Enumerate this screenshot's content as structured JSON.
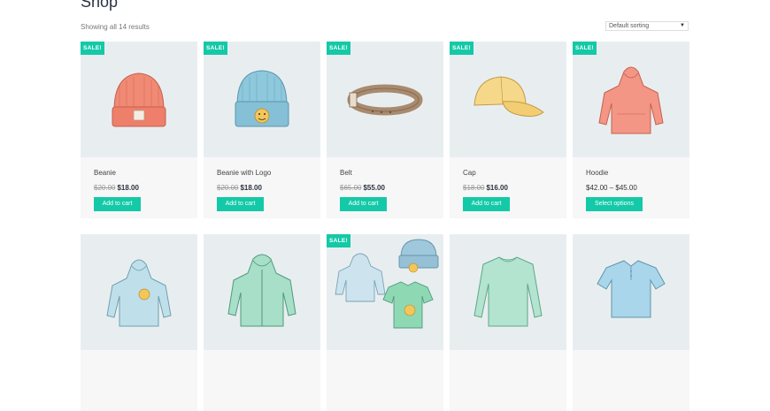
{
  "page": {
    "title": "Shop",
    "results": "Showing all 14 results",
    "sort_selected": "Default sorting"
  },
  "products": [
    {
      "name": "Beanie",
      "old_price": "$20.00",
      "price": "$18.00",
      "sale": "SALE!",
      "button": "Add to cart",
      "icon": "beanie-icon"
    },
    {
      "name": "Beanie with Logo",
      "old_price": "$20.00",
      "price": "$18.00",
      "sale": "SALE!",
      "button": "Add to cart",
      "icon": "beanie-logo-icon"
    },
    {
      "name": "Belt",
      "old_price": "$65.00",
      "price": "$55.00",
      "sale": "SALE!",
      "button": "Add to cart",
      "icon": "belt-icon"
    },
    {
      "name": "Cap",
      "old_price": "$18.00",
      "price": "$16.00",
      "sale": "SALE!",
      "button": "Add to cart",
      "icon": "cap-icon"
    },
    {
      "name": "Hoodie",
      "price_range": "$42.00 – $45.00",
      "sale": "SALE!",
      "button": "Select options",
      "icon": "hoodie-icon"
    },
    {
      "icon": "hoodie-with-logo-icon"
    },
    {
      "icon": "zip-hoodie-icon"
    },
    {
      "sale": "SALE!",
      "icon": "clothing-set-icon"
    },
    {
      "icon": "long-sleeve-tee-icon"
    },
    {
      "icon": "polo-icon"
    }
  ],
  "colors": {
    "accent": "#14c9a7",
    "image_bg": "#e8eef0",
    "card_bg": "#f7f7f7"
  }
}
